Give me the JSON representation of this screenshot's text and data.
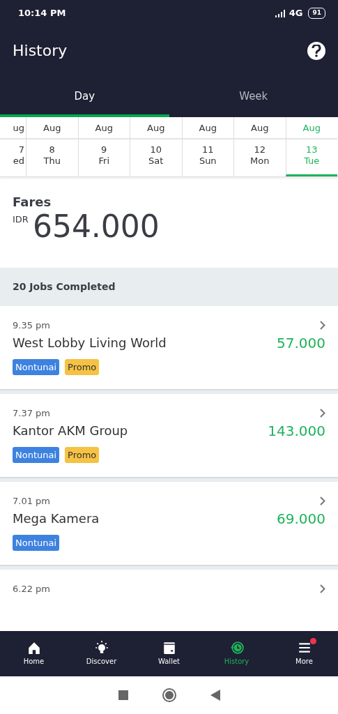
{
  "status_bar": {
    "time": "10:14 PM",
    "network": "4G",
    "battery": "91"
  },
  "header": {
    "title": "History"
  },
  "tabs": [
    {
      "label": "Day",
      "selected": true
    },
    {
      "label": "Week",
      "selected": false
    }
  ],
  "dates": [
    {
      "month": "ug",
      "day": "7",
      "weekday": "ed",
      "selected": false
    },
    {
      "month": "Aug",
      "day": "8",
      "weekday": "Thu",
      "selected": false
    },
    {
      "month": "Aug",
      "day": "9",
      "weekday": "Fri",
      "selected": false
    },
    {
      "month": "Aug",
      "day": "10",
      "weekday": "Sat",
      "selected": false
    },
    {
      "month": "Aug",
      "day": "11",
      "weekday": "Sun",
      "selected": false
    },
    {
      "month": "Aug",
      "day": "12",
      "weekday": "Mon",
      "selected": false
    },
    {
      "month": "Aug",
      "day": "13",
      "weekday": "Tue",
      "selected": true
    }
  ],
  "fares": {
    "label": "Fares",
    "currency": "IDR",
    "amount": "654.000"
  },
  "jobs_header": "20 Jobs Completed",
  "jobs": [
    {
      "time": "9.35 pm",
      "place": "West Lobby Living World",
      "fare": "57.000",
      "tags": [
        {
          "label": "Nontunai",
          "kind": "payment"
        },
        {
          "label": "Promo",
          "kind": "promo"
        }
      ]
    },
    {
      "time": "7.37 pm",
      "place": "Kantor AKM Group",
      "fare": "143.000",
      "tags": [
        {
          "label": "Nontunai",
          "kind": "payment"
        },
        {
          "label": "Promo",
          "kind": "promo"
        }
      ]
    },
    {
      "time": "7.01 pm",
      "place": "Mega Kamera",
      "fare": "69.000",
      "tags": [
        {
          "label": "Nontunai",
          "kind": "payment"
        }
      ]
    },
    {
      "time": "6.22 pm"
    }
  ],
  "bottom_nav": [
    {
      "label": "Home",
      "kind": "home",
      "selected": false,
      "badge": false
    },
    {
      "label": "Discover",
      "kind": "bulb",
      "selected": false,
      "badge": false
    },
    {
      "label": "Wallet",
      "kind": "wallet",
      "selected": false,
      "badge": false
    },
    {
      "label": "History",
      "kind": "history",
      "selected": true,
      "badge": false
    },
    {
      "label": "More",
      "kind": "menu",
      "selected": false,
      "badge": true
    }
  ]
}
